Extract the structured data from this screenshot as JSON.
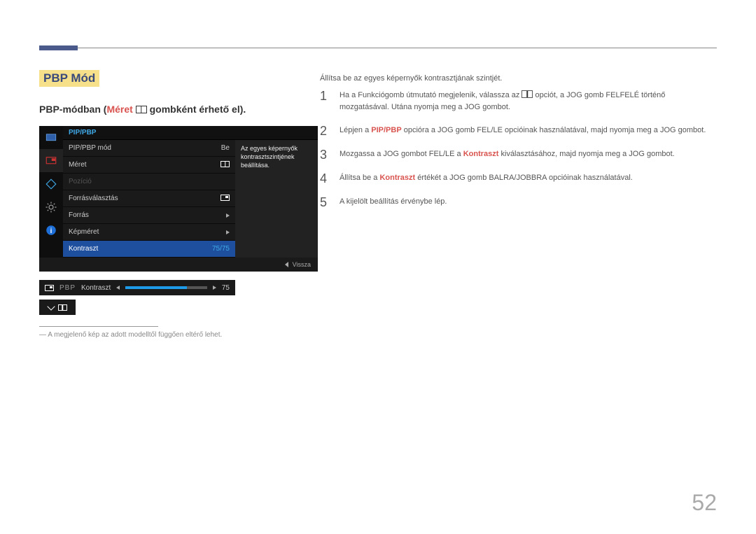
{
  "section_title": "PBP Mód",
  "subheading": {
    "prefix": "PBP-módban (",
    "highlight": "Méret",
    "suffix": " gombként érhető el)."
  },
  "osd": {
    "header": "PIP/PBP",
    "tip": "Az egyes képernyők kontrasztszintjének beállítása.",
    "rows": [
      {
        "label": "PIP/PBP mód",
        "value": "Be",
        "type": "text"
      },
      {
        "label": "Méret",
        "value": "",
        "type": "split-icon"
      },
      {
        "label": "Pozíció",
        "value": "",
        "type": "dim"
      },
      {
        "label": "Forrásválasztás",
        "value": "",
        "type": "inset-icon"
      },
      {
        "label": "Forrás",
        "value": "",
        "type": "arrow"
      },
      {
        "label": "Képméret",
        "value": "",
        "type": "arrow"
      },
      {
        "label": "Kontraszt",
        "value": "75/75",
        "type": "selected"
      }
    ],
    "footer": "Vissza"
  },
  "slider": {
    "mode": "PBP",
    "label": "Kontraszt",
    "value": "75"
  },
  "footnote": "― A megjelenő kép az adott modelltől függően eltérő lehet.",
  "intro": "Állítsa be az egyes képernyők kontrasztjának szintjét.",
  "steps": [
    {
      "n": "1",
      "parts": [
        "Ha a Funkciógomb útmutató megjelenik, válassza az ",
        "[ICON]",
        " opciót, a JOG gomb FELFELÉ történő mozgatásával. Utána nyomja meg a JOG gombot."
      ]
    },
    {
      "n": "2",
      "parts": [
        "Lépjen a ",
        "PIP/PBP",
        " opcióra a JOG gomb FEL/LE opcióinak használatával, majd nyomja meg a JOG gombot."
      ]
    },
    {
      "n": "3",
      "parts": [
        "Mozgassa a JOG gombot FEL/LE a ",
        "Kontraszt",
        " kiválasztásához, majd nyomja meg a JOG gombot."
      ]
    },
    {
      "n": "4",
      "parts": [
        "Állítsa be a ",
        "Kontraszt",
        " értékét a JOG gomb BALRA/JOBBRA opcióinak használatával."
      ]
    },
    {
      "n": "5",
      "parts": [
        "A kijelölt beállítás érvénybe lép."
      ]
    }
  ],
  "page_number": "52"
}
